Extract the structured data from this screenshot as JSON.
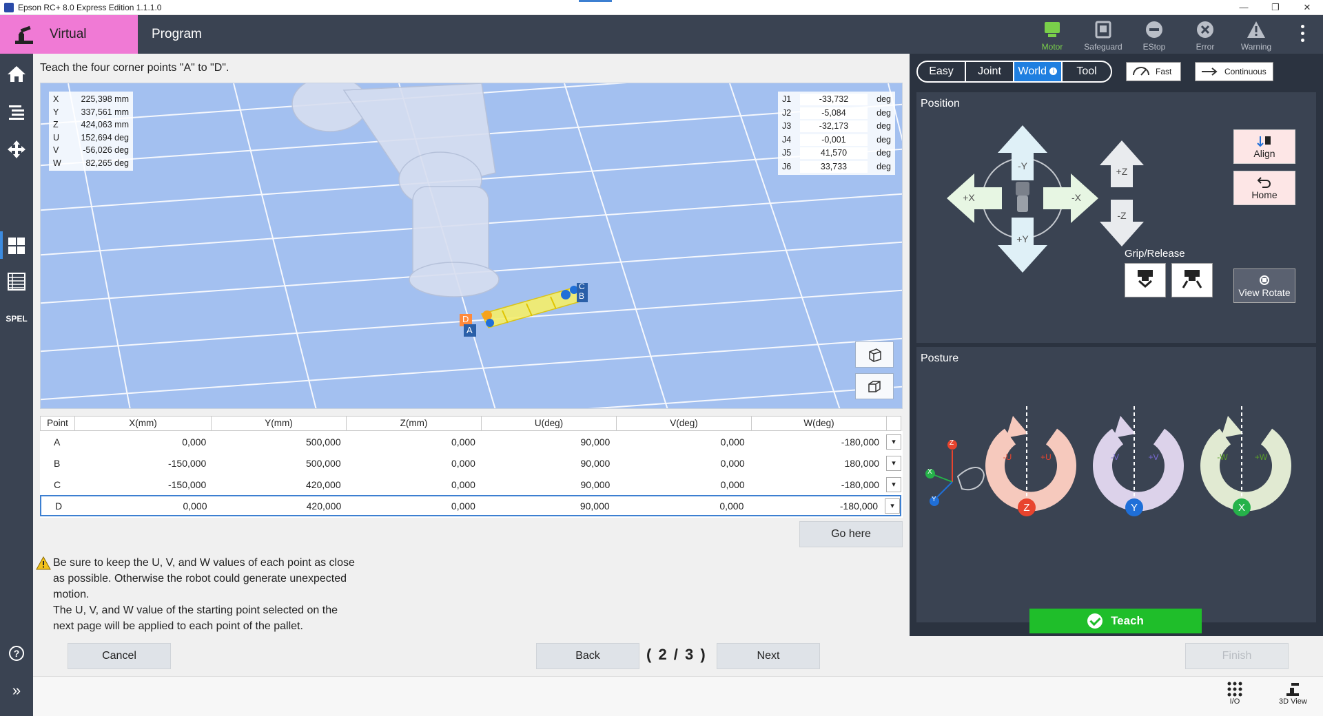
{
  "window": {
    "title": "Epson RC+ 8.0 Express Edition 1.1.1.0",
    "controls": [
      "—",
      "❐",
      "✕"
    ]
  },
  "header": {
    "mode": "Virtual",
    "program": "Program",
    "status": [
      {
        "label": "Motor",
        "active": true
      },
      {
        "label": "Safeguard",
        "active": false
      },
      {
        "label": "EStop",
        "active": false
      },
      {
        "label": "Error",
        "active": false
      },
      {
        "label": "Warning",
        "active": false
      }
    ]
  },
  "nav": {
    "spel": "SPEL",
    "help": "?",
    "expand": "»"
  },
  "instruction": "Teach the four corner points \"A\" to \"D\".",
  "coords": [
    {
      "axis": "X",
      "value": "225,398 mm"
    },
    {
      "axis": "Y",
      "value": "337,561 mm"
    },
    {
      "axis": "Z",
      "value": "424,063 mm"
    },
    {
      "axis": "U",
      "value": "152,694 deg"
    },
    {
      "axis": "V",
      "value": "-56,026 deg"
    },
    {
      "axis": "W",
      "value": "82,265 deg"
    }
  ],
  "joints": [
    {
      "name": "J1",
      "value": "-33,732",
      "unit": "deg"
    },
    {
      "name": "J2",
      "value": "-5,084",
      "unit": "deg"
    },
    {
      "name": "J3",
      "value": "-32,173",
      "unit": "deg"
    },
    {
      "name": "J4",
      "value": "-0,001",
      "unit": "deg"
    },
    {
      "name": "J5",
      "value": "41,570",
      "unit": "deg"
    },
    {
      "name": "J6",
      "value": "33,733",
      "unit": "deg"
    }
  ],
  "pallet_labels": {
    "a": "A",
    "b": "B",
    "c": "C",
    "d": "D"
  },
  "table": {
    "headers": [
      "Point",
      "X(mm)",
      "Y(mm)",
      "Z(mm)",
      "U(deg)",
      "V(deg)",
      "W(deg)"
    ],
    "rows": [
      {
        "point": "A",
        "x": "0,000",
        "y": "500,000",
        "z": "0,000",
        "u": "90,000",
        "v": "0,000",
        "w": "-180,000"
      },
      {
        "point": "B",
        "x": "-150,000",
        "y": "500,000",
        "z": "0,000",
        "u": "90,000",
        "v": "0,000",
        "w": "180,000"
      },
      {
        "point": "C",
        "x": "-150,000",
        "y": "420,000",
        "z": "0,000",
        "u": "90,000",
        "v": "0,000",
        "w": "-180,000"
      },
      {
        "point": "D",
        "x": "0,000",
        "y": "420,000",
        "z": "0,000",
        "u": "90,000",
        "v": "0,000",
        "w": "-180,000"
      }
    ]
  },
  "go_here": "Go here",
  "warning": {
    "line1": "Be sure to keep the U, V, and W values of each point as close",
    "line2": "as possible. Otherwise the robot could generate unexpected",
    "line3": "motion.",
    "line4": "The U, V, and W value of the starting point selected on the",
    "line5": "next page will be applied to each point of the pallet."
  },
  "footer": {
    "cancel": "Cancel",
    "back": "Back",
    "page": "( 2 / 3 )",
    "next": "Next",
    "finish": "Finish",
    "io": "I/O",
    "view3d": "3D View"
  },
  "jog": {
    "modes": [
      "Easy",
      "Joint",
      "World",
      "Tool"
    ],
    "selected_mode": "World",
    "speed": "Fast",
    "step": "Continuous",
    "position_title": "Position",
    "posture_title": "Posture",
    "minus_y": "-Y",
    "plus_y": "+Y",
    "plus_x": "+X",
    "minus_x": "-X",
    "plus_z": "+Z",
    "minus_z": "-Z",
    "align": "Align",
    "home": "Home",
    "grip_release": "Grip/Release",
    "view_rotate": "View Rotate",
    "rot": {
      "minus_u": "-U",
      "plus_u": "+U",
      "z": "Z",
      "minus_v": "-V",
      "plus_v": "+V",
      "y": "Y",
      "minus_w": "-W",
      "plus_w": "+W",
      "x": "X"
    },
    "teach": "Teach"
  },
  "colors": {
    "header": "#3a4352",
    "virtual_tab": "#f07ad5",
    "viewport": "#a3c0f0",
    "accent": "#1f7fe0",
    "teach": "#1fbe2a"
  }
}
